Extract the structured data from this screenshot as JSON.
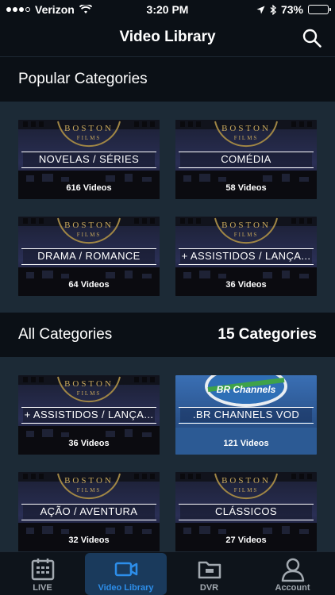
{
  "status": {
    "carrier": "Verizon",
    "time": "3:20 PM",
    "battery": "73%"
  },
  "nav": {
    "title": "Video Library"
  },
  "popular": {
    "title": "Popular Categories",
    "tiles": [
      {
        "name": "NOVELAS / SÉRIES",
        "count": "616 Videos"
      },
      {
        "name": "COMÉDIA",
        "count": "58 Videos"
      },
      {
        "name": "DRAMA / ROMANCE",
        "count": "64 Videos"
      },
      {
        "name": "+ ASSISTIDOS / LANÇA...",
        "count": "36 Videos"
      }
    ]
  },
  "all": {
    "title": "All Categories",
    "count_label": "15 Categories",
    "tiles": [
      {
        "name": "+ ASSISTIDOS / LANÇA...",
        "count": "36 Videos"
      },
      {
        "name": ".BR CHANNELS VOD",
        "count": "121 Videos",
        "banner": "BR Channels"
      },
      {
        "name": "AÇÃO / AVENTURA",
        "count": "32 Videos"
      },
      {
        "name": "CLÁSSICOS",
        "count": "27 Videos"
      }
    ]
  },
  "tile_brand": {
    "line1": "BOSTON",
    "line2": "FILMS"
  },
  "tabs": [
    {
      "label": "LIVE",
      "icon": "calendar-icon",
      "active": false
    },
    {
      "label": "Video Library",
      "icon": "video-camera-icon",
      "active": true
    },
    {
      "label": "DVR",
      "icon": "folder-icon",
      "active": false
    },
    {
      "label": "Account",
      "icon": "person-icon",
      "active": false
    }
  ],
  "colors": {
    "accent": "#2d8eea",
    "header_bg": "#0b1016",
    "content_bg": "#1c2a36"
  }
}
